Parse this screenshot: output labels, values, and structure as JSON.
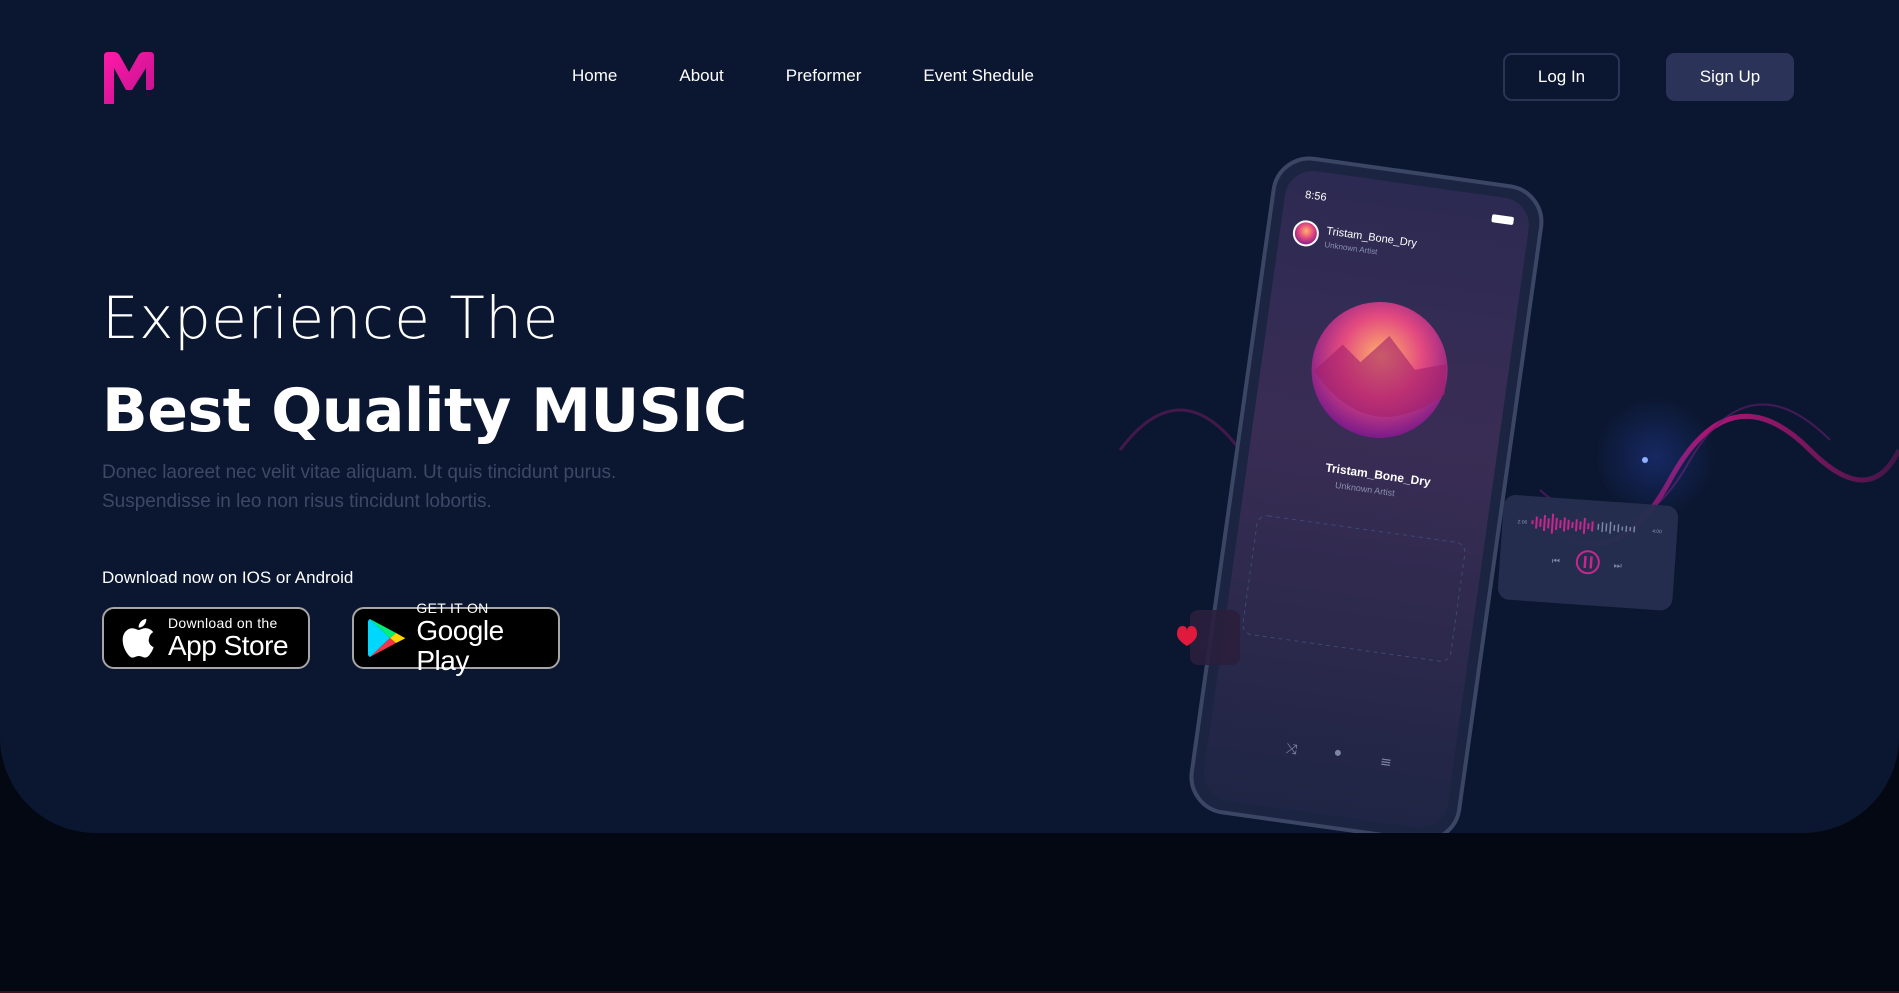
{
  "brand": {
    "logo_letter": "M",
    "accent": "#ff1aa8",
    "accent2": "#b4158f"
  },
  "nav": {
    "items": [
      {
        "label": "Home"
      },
      {
        "label": "About"
      },
      {
        "label": "Preformer"
      },
      {
        "label": "Event Shedule"
      }
    ]
  },
  "auth": {
    "login_label": "Log In",
    "signup_label": "Sign Up"
  },
  "hero": {
    "headline_line1": "Experience The",
    "headline_line2": "Best Quality MUSIC",
    "subtext": "Donec laoreet nec velit vitae aliquam. Ut quis tincidunt purus. Suspendisse in leo non risus tincidunt lobortis.",
    "download_label": "Download now on IOS or Android"
  },
  "stores": {
    "appstore": {
      "small": "Download on the",
      "big": "App Store",
      "icon": "apple-icon"
    },
    "google": {
      "small": "GET IT ON",
      "big": "Google Play",
      "icon": "google-play-icon"
    }
  },
  "phone": {
    "time": "8:56",
    "track_title": "Tristam_Bone_Dry",
    "artist": "Unknown Artist",
    "elapsed": "2:06",
    "duration": "4:00"
  },
  "colors": {
    "hero_bg": "#0b1731",
    "page_bg": "#030812",
    "button_bg": "#2b3458",
    "muted_text": "#3d4866"
  }
}
